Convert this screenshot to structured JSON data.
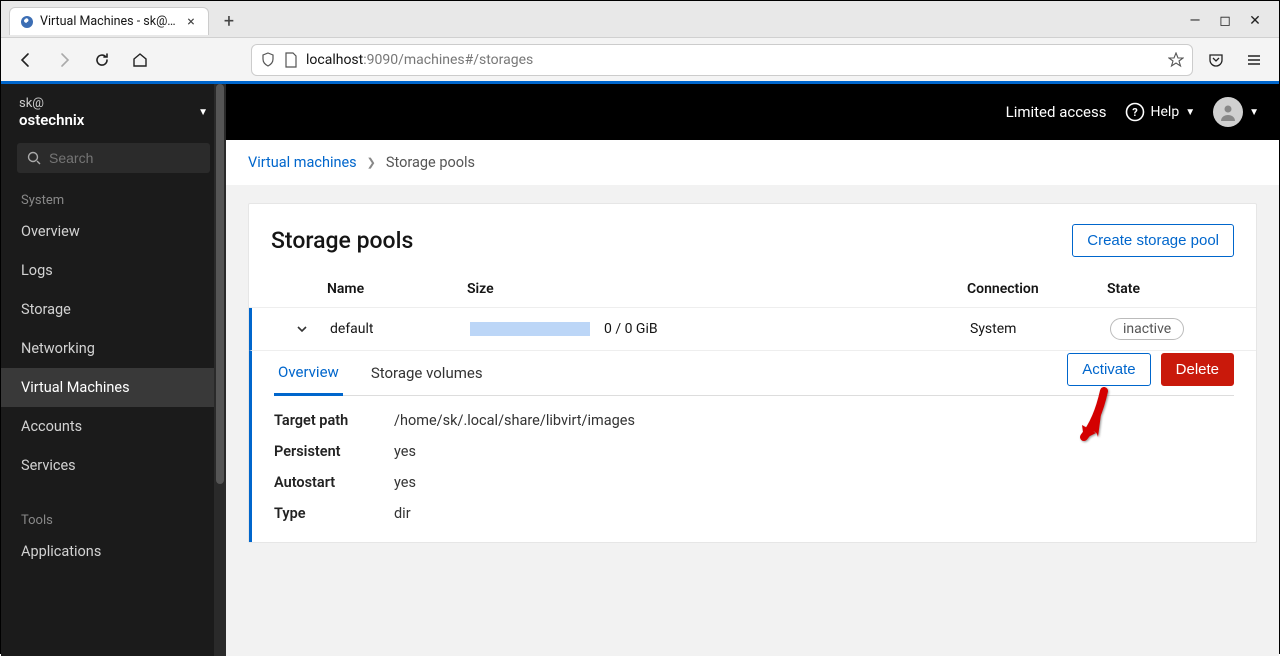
{
  "browser": {
    "tab_title": "Virtual Machines - sk@os",
    "url_host": "localhost",
    "url_port": ":9090",
    "url_path": "/machines#/storages"
  },
  "sidebar": {
    "user": "sk@",
    "host": "ostechnix",
    "search_placeholder": "Search",
    "section_system": "System",
    "items": [
      "Overview",
      "Logs",
      "Storage",
      "Networking",
      "Virtual Machines",
      "Accounts",
      "Services"
    ],
    "section_tools": "Tools",
    "tools": [
      "Applications"
    ]
  },
  "topbar": {
    "limited": "Limited access",
    "help": "Help"
  },
  "breadcrumb": {
    "root": "Virtual machines",
    "current": "Storage pools"
  },
  "page": {
    "title": "Storage pools",
    "create": "Create storage pool",
    "col_name": "Name",
    "col_size": "Size",
    "col_conn": "Connection",
    "col_state": "State"
  },
  "pool": {
    "name": "default",
    "size": "0 / 0 GiB",
    "connection": "System",
    "state": "inactive"
  },
  "tabs": {
    "overview": "Overview",
    "volumes": "Storage volumes"
  },
  "actions": {
    "activate": "Activate",
    "delete": "Delete"
  },
  "details": {
    "target_path_k": "Target path",
    "target_path_v": "/home/sk/.local/share/libvirt/images",
    "persistent_k": "Persistent",
    "persistent_v": "yes",
    "autostart_k": "Autostart",
    "autostart_v": "yes",
    "type_k": "Type",
    "type_v": "dir"
  }
}
